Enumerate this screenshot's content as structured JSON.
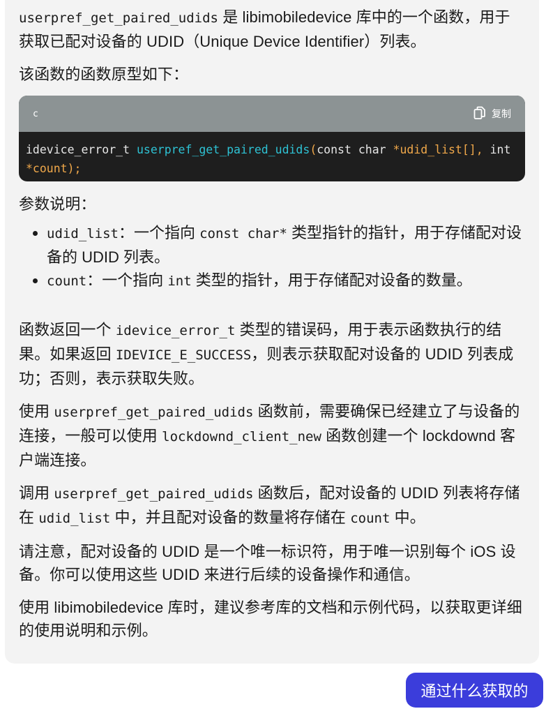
{
  "assistant": {
    "intro": {
      "fn_name": "userpref_get_paired_udids",
      "text": " 是 libimobiledevice 库中的一个函数，用于获取已配对设备的 UDID（Unique Device Identifier）列表。"
    },
    "prototype_intro": "该函数的函数原型如下：",
    "code": {
      "language": "c",
      "copy_label": "复制",
      "tokens": {
        "ret_type": "idevice_error_t ",
        "fn": "userpref_get_paired_udids",
        "open": "(",
        "arg1_type": "const char ",
        "arg1": "*udid_list[]",
        "comma": ", ",
        "arg2_type": "int ",
        "arg2": "*count",
        "close": ");"
      }
    },
    "params_heading": "参数说明：",
    "params": [
      {
        "name": "udid_list",
        "sep": "：一个指向 ",
        "code": "const char*",
        "desc": " 类型指针的指针，用于存储配对设备的 UDID 列表。"
      },
      {
        "name": "count",
        "sep": "：一个指向 ",
        "code": "int",
        "desc": " 类型的指针，用于存储配对设备的数量。"
      }
    ],
    "return_para": {
      "a": "函数返回一个 ",
      "code1": "idevice_error_t",
      "b": " 类型的错误码，用于表示函数执行的结果。如果返回 ",
      "code2": "IDEVICE_E_SUCCESS",
      "c": "，则表示获取配对设备的 UDID 列表成功；否则，表示获取失败。"
    },
    "usage_para": {
      "a": "使用 ",
      "code1": "userpref_get_paired_udids",
      "b": " 函数前，需要确保已经建立了与设备的连接，一般可以使用 ",
      "code2": "lockdownd_client_new",
      "c": " 函数创建一个 lockdownd 客户端连接。"
    },
    "after_para": {
      "a": "调用 ",
      "code1": "userpref_get_paired_udids",
      "b": " 函数后，配对设备的 UDID 列表将存储在 ",
      "code2": "udid_list",
      "c": " 中，并且配对设备的数量将存储在 ",
      "code3": "count",
      "d": " 中。"
    },
    "note_para": "请注意，配对设备的 UDID 是一个唯一标识符，用于唯一识别每个 iOS 设备。你可以使用这些 UDID 来进行后续的设备操作和通信。",
    "final_para": "使用 libimobiledevice 库时，建议参考库的文档和示例代码，以获取更详细的使用说明和示例。"
  },
  "user_message": "通过什么获取的",
  "colors": {
    "bubble_bg": "#f3f3f3",
    "code_header_bg": "#8c9394",
    "code_bg": "#1e1e1e",
    "code_fn": "#2ec2d4",
    "code_param": "#f0a84a",
    "user_bubble": "#3b3ddb"
  },
  "icons": {
    "copy": "copy-icon"
  }
}
